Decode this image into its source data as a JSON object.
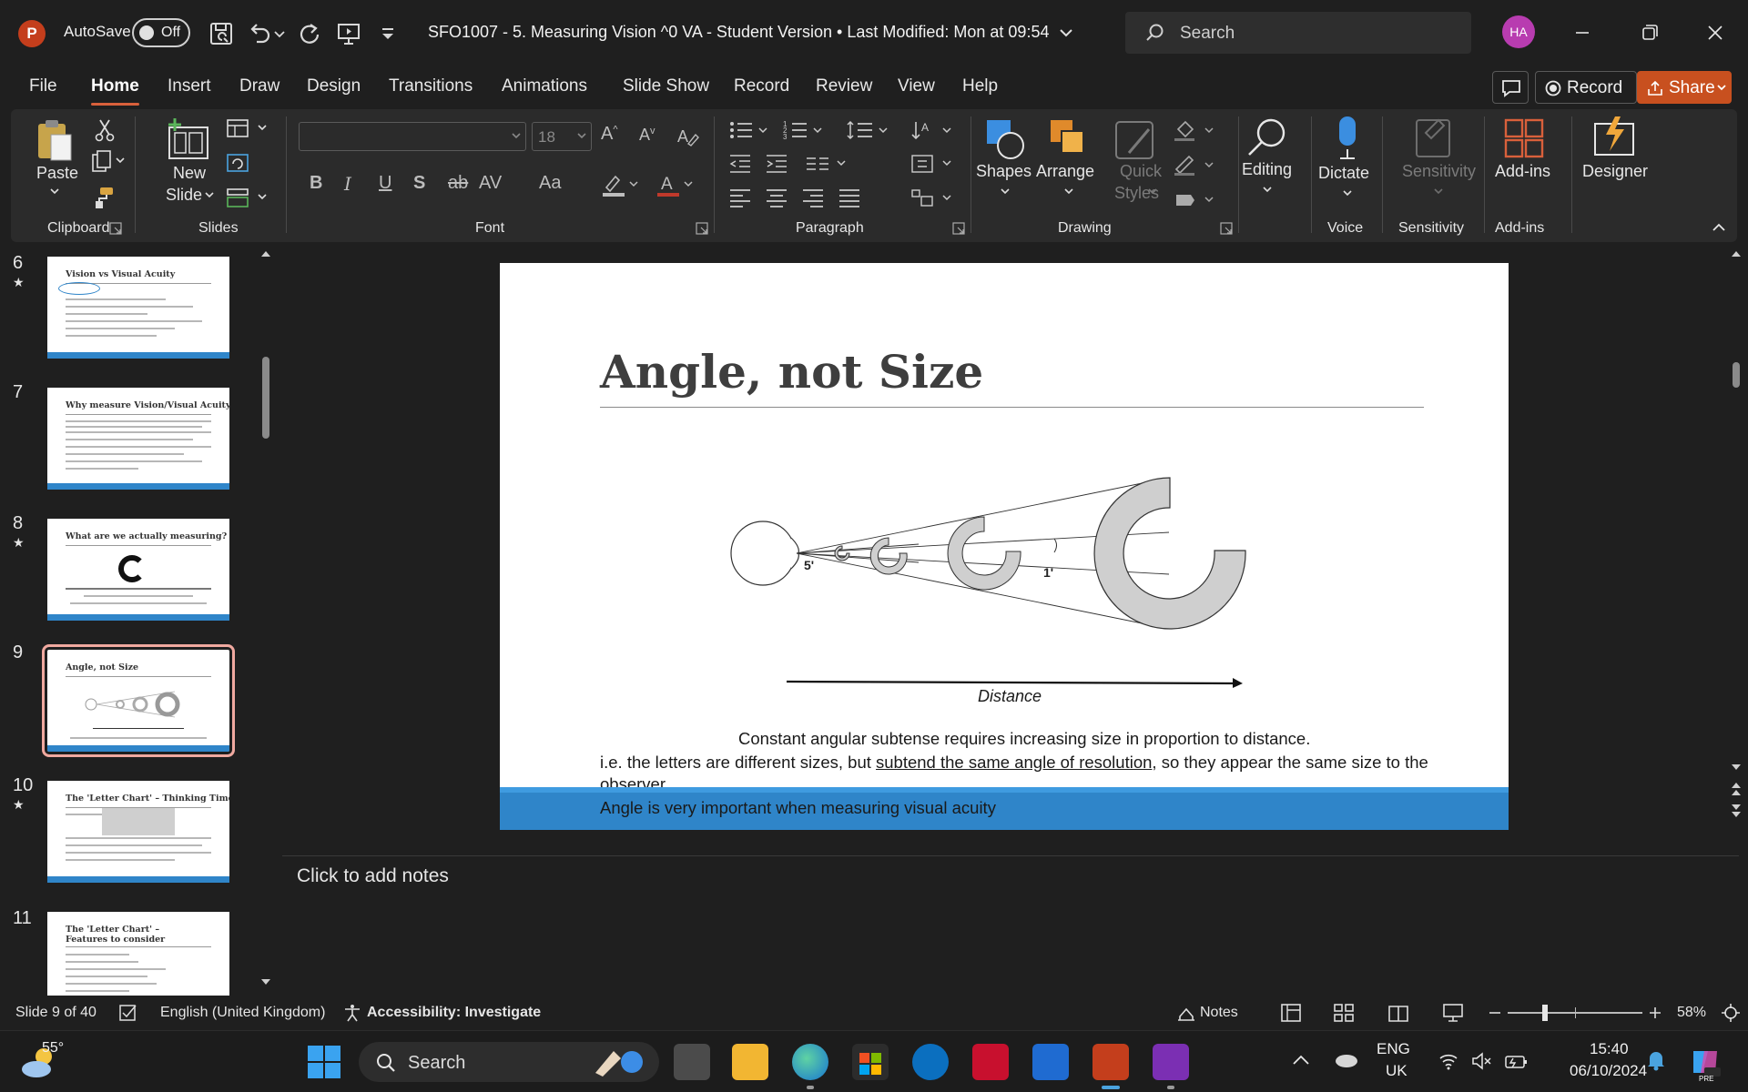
{
  "app": {
    "logo_letter": "P",
    "autosave_label": "AutoSave",
    "autosave_state": "Off",
    "doc_title": "SFO1007 - 5. Measuring Vision ^0 VA - Student Version • Last Modified: Mon at 09:54",
    "search_placeholder": "Search",
    "avatar_initials": "HA"
  },
  "menu": {
    "tabs": [
      "File",
      "Home",
      "Insert",
      "Draw",
      "Design",
      "Transitions",
      "Animations",
      "Slide Show",
      "Record",
      "Review",
      "View",
      "Help"
    ],
    "active": "Home",
    "record_label": "Record",
    "share_label": "Share"
  },
  "ribbon": {
    "clipboard": {
      "paste": "Paste",
      "group": "Clipboard"
    },
    "slides": {
      "new_slide_1": "New",
      "new_slide_2": "Slide",
      "group": "Slides"
    },
    "font": {
      "font_name": "",
      "font_size": "18",
      "group": "Font"
    },
    "paragraph": {
      "group": "Paragraph"
    },
    "drawing": {
      "shapes": "Shapes",
      "arrange": "Arrange",
      "quick_styles_1": "Quick",
      "quick_styles_2": "Styles",
      "group": "Drawing"
    },
    "editing": {
      "label": "Editing"
    },
    "voice": {
      "dictate": "Dictate",
      "group": "Voice"
    },
    "sensitivity": {
      "label": "Sensitivity",
      "group": "Sensitivity"
    },
    "addins": {
      "label": "Add-ins",
      "group": "Add-ins"
    },
    "designer": {
      "label": "Designer"
    }
  },
  "thumbnails": [
    {
      "num": "6",
      "star": true,
      "title": "Vision vs Visual Acuity",
      "selected": false
    },
    {
      "num": "7",
      "star": false,
      "title": "Why measure Vision/Visual Acuity?",
      "selected": false
    },
    {
      "num": "8",
      "star": true,
      "title": "What are we actually measuring?",
      "selected": false
    },
    {
      "num": "9",
      "star": false,
      "title": "Angle, not Size",
      "selected": true
    },
    {
      "num": "10",
      "star": true,
      "title": "The 'Letter Chart' – Thinking Time",
      "selected": false
    },
    {
      "num": "11",
      "star": false,
      "title": "The 'Letter Chart' – Features to consider",
      "selected": false
    }
  ],
  "slide": {
    "title": "Angle, not Size",
    "label_5": "5'",
    "label_1": "1'",
    "distance_label": "Distance",
    "caption": "Constant angular subtense requires increasing size in proportion to distance.",
    "body_pre": "i.e. the letters are different sizes, but ",
    "body_underlined": "subtend the same angle of resolution",
    "body_post": ", so they appear the same size to the observer.",
    "footer_text": "Angle is very important when measuring visual acuity"
  },
  "notes": {
    "placeholder": "Click to add notes"
  },
  "status": {
    "slide_info": "Slide 9 of 40",
    "language": "English (United Kingdom)",
    "accessibility": "Accessibility: Investigate",
    "notes_label": "Notes",
    "zoom": "58%"
  },
  "taskbar": {
    "weather_temp": "55°",
    "search_placeholder": "Search",
    "lang_1": "ENG",
    "lang_2": "UK",
    "time": "15:40",
    "date": "06/10/2024"
  },
  "colors": {
    "accent": "#c43e1c",
    "share": "#c8501f",
    "slide_bar": "#2f85c9"
  }
}
